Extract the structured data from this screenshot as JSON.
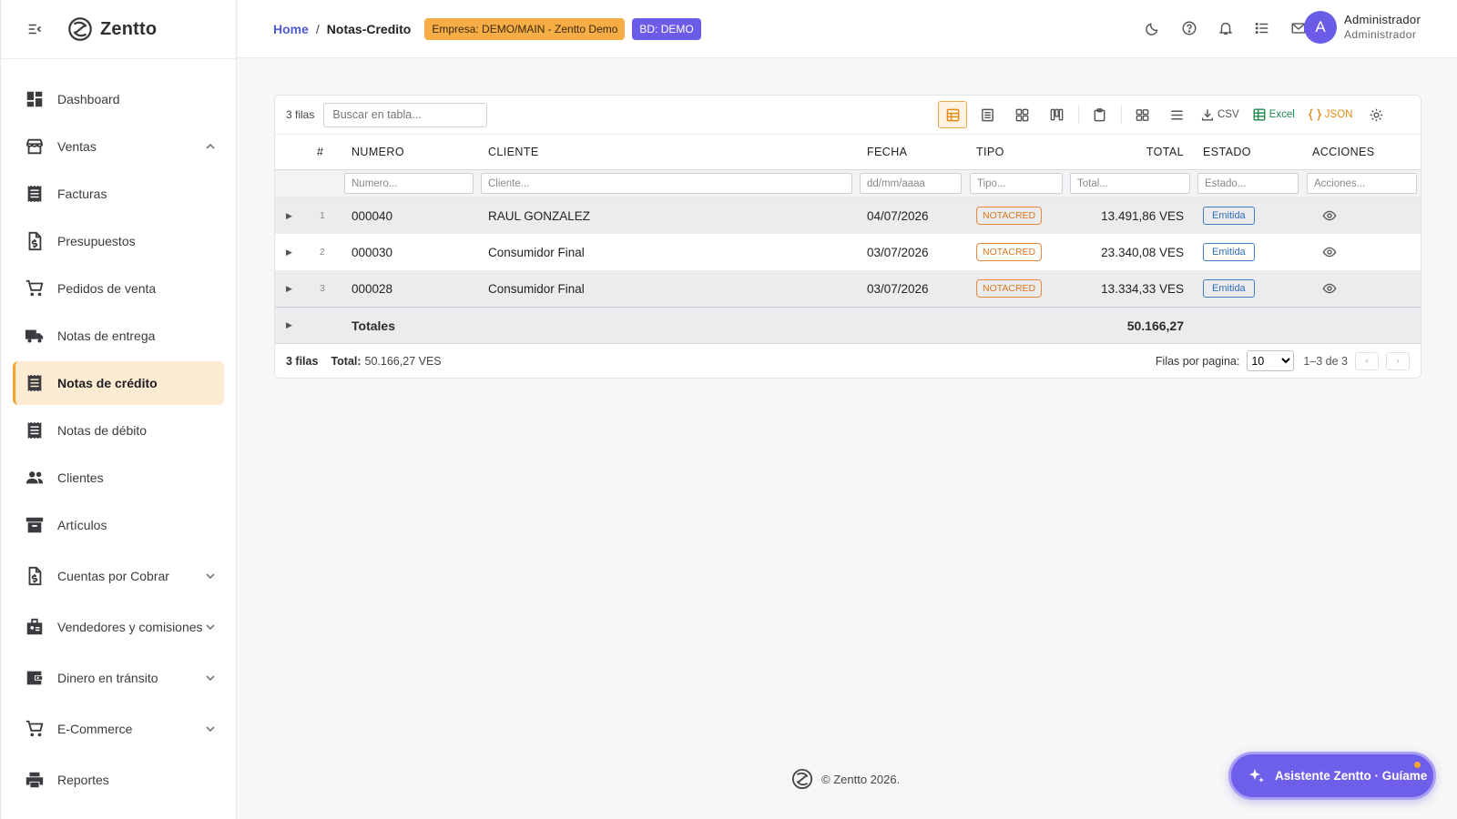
{
  "brand": {
    "name": "Zentto"
  },
  "sidebar": {
    "items": [
      {
        "label": "Dashboard",
        "icon": "dashboard-icon"
      },
      {
        "label": "Ventas",
        "icon": "store-icon",
        "chevron": "up"
      },
      {
        "label": "Facturas",
        "icon": "receipt-icon"
      },
      {
        "label": "Presupuestos",
        "icon": "document-dollar-icon"
      },
      {
        "label": "Pedidos de venta",
        "icon": "cart-icon"
      },
      {
        "label": "Notas de entrega",
        "icon": "truck-icon"
      },
      {
        "label": "Notas de crédito",
        "icon": "receipt-icon",
        "active": true
      },
      {
        "label": "Notas de débito",
        "icon": "receipt-icon"
      },
      {
        "label": "Clientes",
        "icon": "people-icon"
      },
      {
        "label": "Artículos",
        "icon": "archive-icon"
      },
      {
        "label": "Cuentas por Cobrar",
        "icon": "document-dollar-icon",
        "chevron": "down"
      },
      {
        "label": "Vendedores y comisiones",
        "icon": "badge-icon",
        "chevron": "down"
      },
      {
        "label": "Dinero en tránsito",
        "icon": "wallet-icon",
        "chevron": "down"
      },
      {
        "label": "E-Commerce",
        "icon": "cart-icon",
        "chevron": "down"
      },
      {
        "label": "Reportes",
        "icon": "printer-icon"
      }
    ]
  },
  "header": {
    "breadcrumb_home": "Home",
    "breadcrumb_sep": "/",
    "breadcrumb_current": "Notas-Credito",
    "empresa_badge": "Empresa: DEMO/MAIN - Zentto Demo",
    "bd_badge": "BD: DEMO",
    "user_initial": "A",
    "user_name": "Administrador",
    "user_role": "Administrador"
  },
  "table": {
    "rows_count_label": "3 filas",
    "search_placeholder": "Buscar en tabla...",
    "export_csv": "CSV",
    "export_excel": "Excel",
    "export_json": "JSON",
    "columns": {
      "index": "#",
      "numero": "NUMERO",
      "cliente": "CLIENTE",
      "fecha": "FECHA",
      "tipo": "TIPO",
      "total": "TOTAL",
      "estado": "ESTADO",
      "acciones": "ACCIONES"
    },
    "filters": {
      "numero": "Numero...",
      "cliente": "Cliente...",
      "fecha": "dd/mm/aaaa",
      "tipo": "Tipo...",
      "total": "Total...",
      "estado": "Estado...",
      "acciones": "Acciones..."
    },
    "rows": [
      {
        "idx": "1",
        "numero": "000040",
        "cliente": "RAUL GONZALEZ",
        "fecha": "04/07/2026",
        "tipo": "NOTACRED",
        "total": "13.491,86 VES",
        "estado": "Emitida"
      },
      {
        "idx": "2",
        "numero": "000030",
        "cliente": "Consumidor Final",
        "fecha": "03/07/2026",
        "tipo": "NOTACRED",
        "total": "23.340,08 VES",
        "estado": "Emitida"
      },
      {
        "idx": "3",
        "numero": "000028",
        "cliente": "Consumidor Final",
        "fecha": "03/07/2026",
        "tipo": "NOTACRED",
        "total": "13.334,33 VES",
        "estado": "Emitida"
      }
    ],
    "totals_label": "Totales",
    "totals_value": "50.166,27",
    "footer_rows": "3 filas",
    "footer_total_label": "Total:",
    "footer_total_value": "50.166,27 VES",
    "rows_per_page_label": "Filas por pagina:",
    "rows_per_page_value": "10",
    "range_label": "1–3 de 3"
  },
  "footer": {
    "copyright": "© Zentto 2026."
  },
  "assistant": {
    "label": "Asistente Zentto · Guíame"
  },
  "colors": {
    "accent": "#f4a532",
    "primary": "#6b5ce7",
    "link": "#4f5bd5",
    "active_bg": "#fdebd2"
  }
}
